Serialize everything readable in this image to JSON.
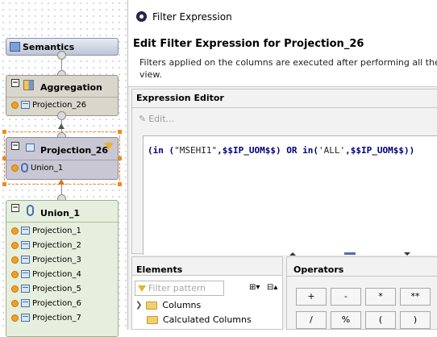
{
  "diagram": {
    "semantics_label": "Semantics",
    "aggregation": {
      "title": "Aggregation",
      "rows": [
        "Projection_26"
      ]
    },
    "projection26": {
      "title": "Projection_26",
      "rows": [
        "Union_1"
      ]
    },
    "union1": {
      "title": "Union_1",
      "rows": [
        "Projection_1",
        "Projection_2",
        "Projection_3",
        "Projection_4",
        "Projection_5",
        "Projection_6",
        "Projection_7"
      ]
    }
  },
  "dialog": {
    "window_title": "Filter Expression",
    "header_title": "Edit Filter Expression for Projection_26",
    "description_line1": "Filters applied on the columns are executed after performing all the op",
    "description_line2": "view.",
    "expression_editor_label": "Expression Editor",
    "edit_button_label": "Edit...",
    "expression": {
      "p1": "(in (",
      "s1": "\"MSEHI1\"",
      "p2": ",$$IP_UOM$$)",
      "or": " OR ",
      "p3": "in(",
      "s2": "'ALL'",
      "p4": ",$$IP_UOM$$))"
    },
    "elements_label": "Elements",
    "filter_placeholder": "Filter pattern",
    "tree": [
      "Columns",
      "Calculated Columns"
    ],
    "operators_label": "Operators",
    "operators_row1": [
      "+",
      "-",
      "*",
      "**"
    ],
    "operators_row2": [
      "/",
      "%",
      "(",
      ")"
    ]
  },
  "colors": {
    "accent_orange": "#f08a1c",
    "node_gray": "#d9d6cc",
    "union_green": "#e6eedd"
  }
}
